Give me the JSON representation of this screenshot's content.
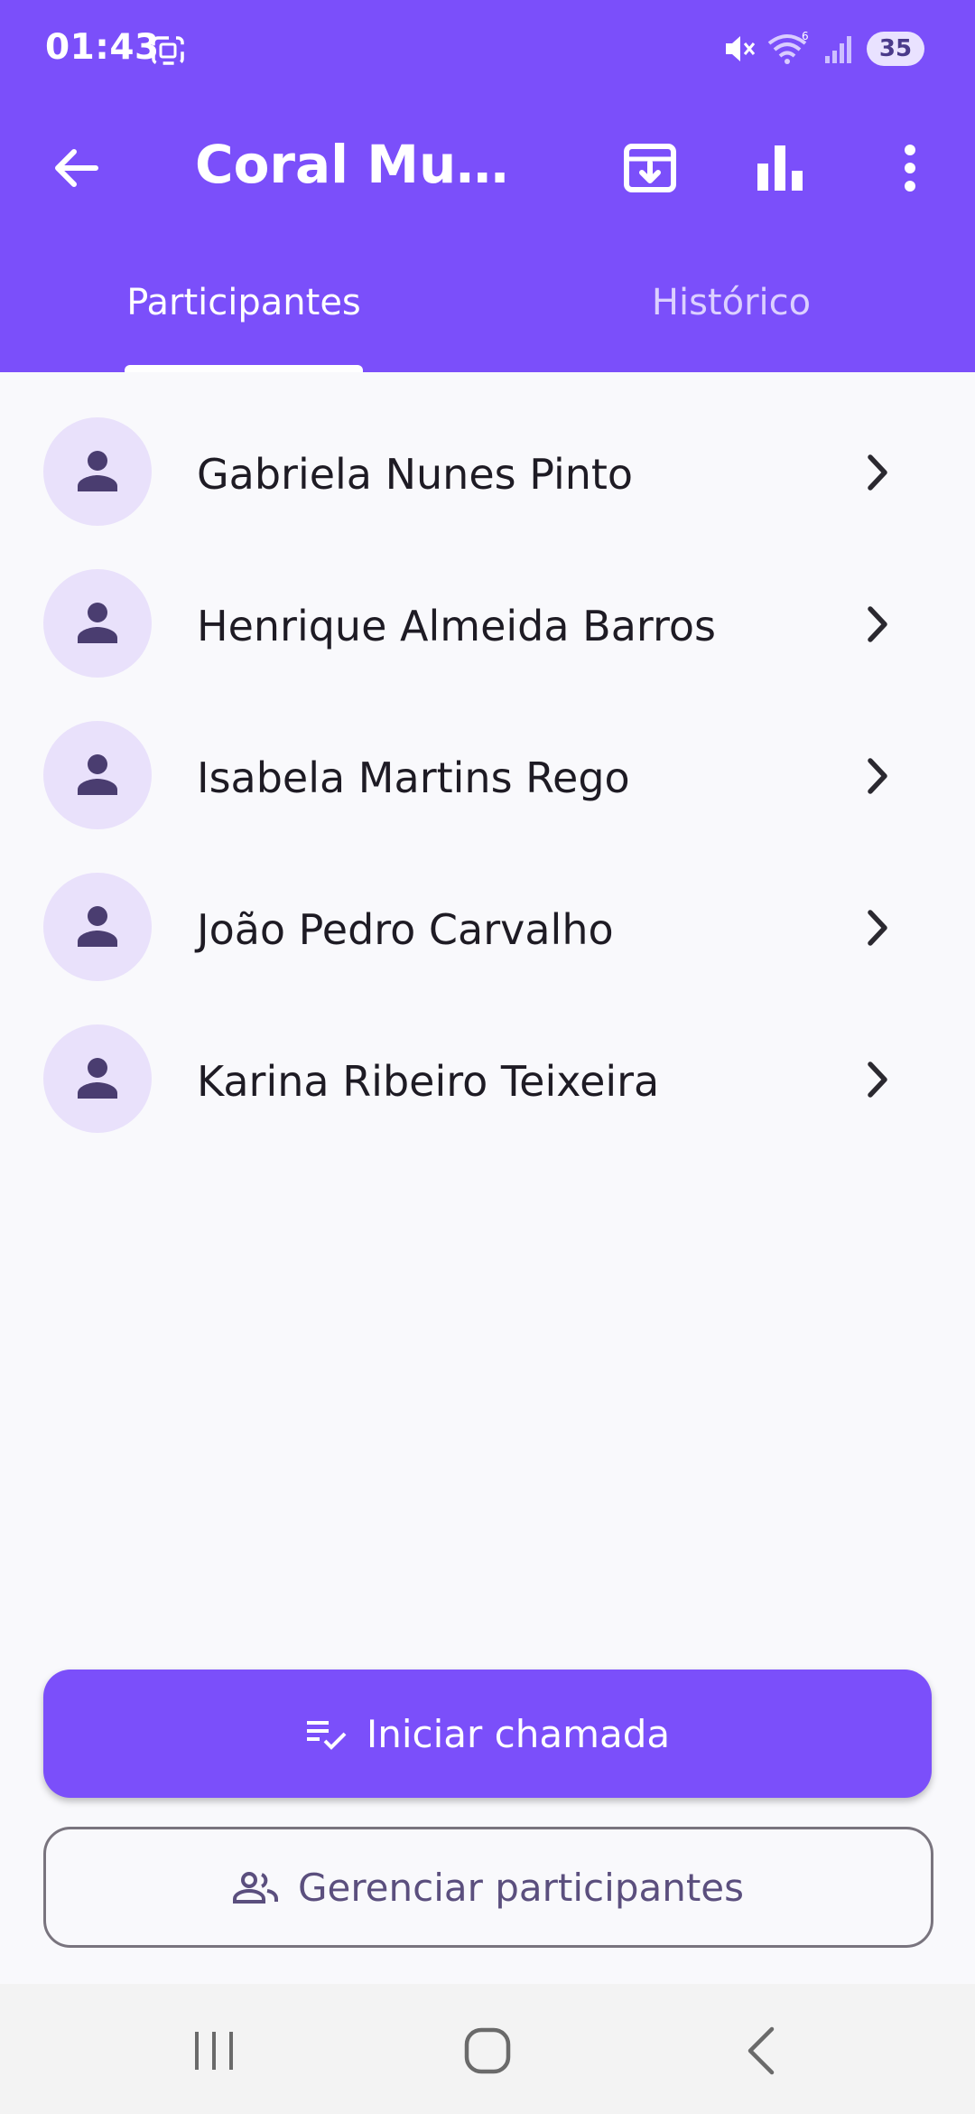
{
  "status_bar": {
    "time": "01:43",
    "battery": "35",
    "wifi_badge": "6"
  },
  "toolbar": {
    "title": "Coral Muni...",
    "back_icon": "arrow-left-icon",
    "archive_icon": "archive-download-icon",
    "stats_icon": "bar-chart-icon",
    "more_icon": "more-vertical-icon"
  },
  "tabs": [
    {
      "label": "Participantes",
      "active": true
    },
    {
      "label": "Histórico",
      "active": false
    }
  ],
  "participants": [
    {
      "name": "Gabriela Nunes Pinto"
    },
    {
      "name": "Henrique Almeida Barros"
    },
    {
      "name": "Isabela Martins Rego"
    },
    {
      "name": "João Pedro Carvalho"
    },
    {
      "name": "Karina Ribeiro Teixeira"
    }
  ],
  "actions": {
    "start_call_label": "Iniciar chamada",
    "manage_label": "Gerenciar participantes"
  },
  "colors": {
    "primary": "#7b4ffa",
    "avatar_bg": "#e9e1fb",
    "background": "#f9f9fc"
  }
}
